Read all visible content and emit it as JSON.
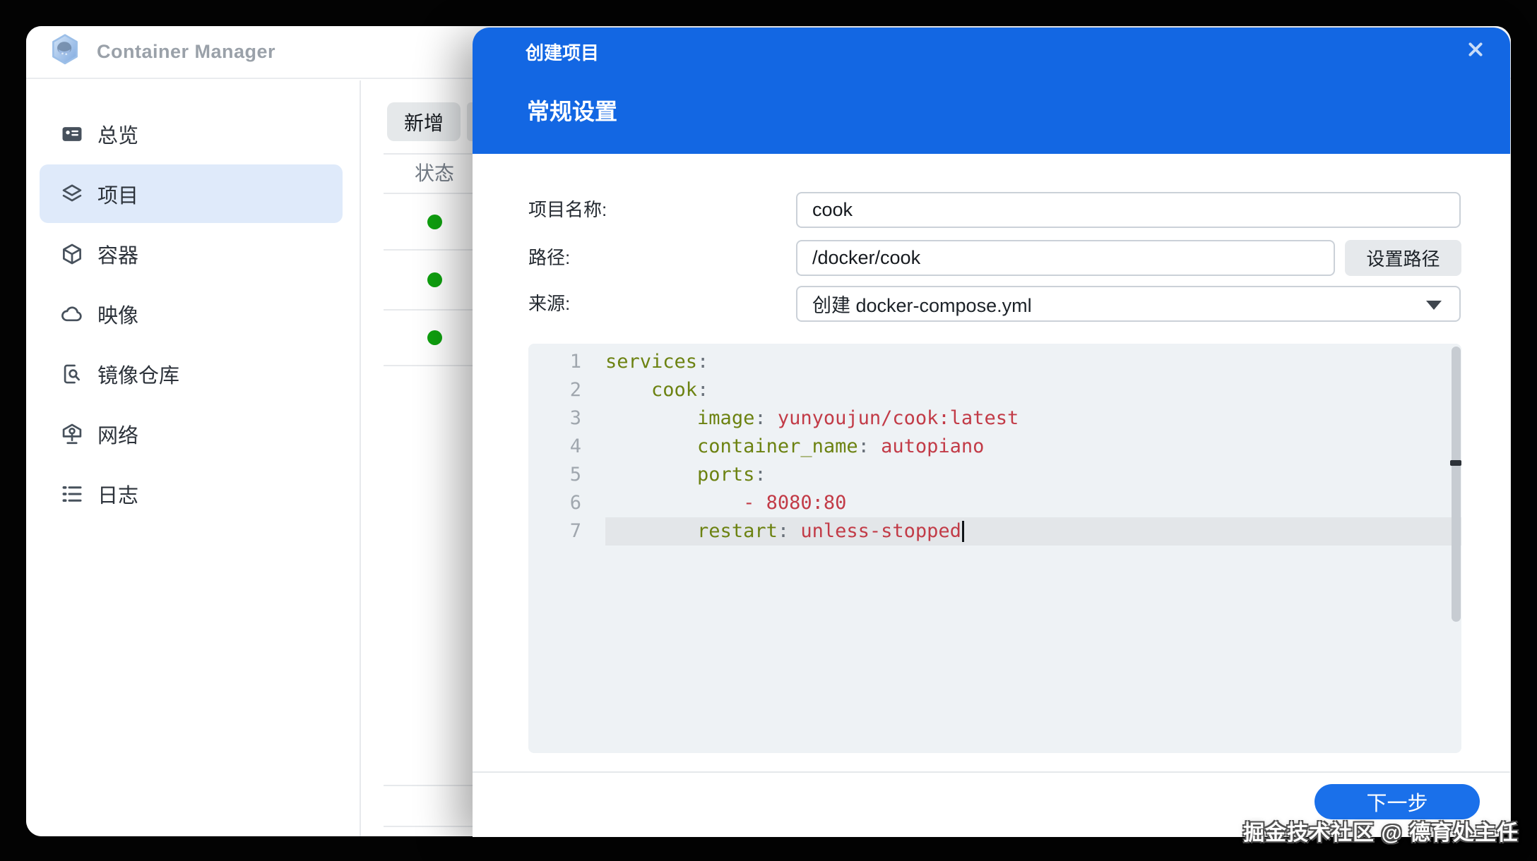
{
  "app": {
    "title": "Container Manager"
  },
  "sidebar": {
    "items": [
      {
        "id": "overview",
        "label": "总览",
        "active": false
      },
      {
        "id": "projects",
        "label": "项目",
        "active": true
      },
      {
        "id": "containers",
        "label": "容器",
        "active": false
      },
      {
        "id": "images",
        "label": "映像",
        "active": false
      },
      {
        "id": "registry",
        "label": "镜像仓库",
        "active": false
      },
      {
        "id": "network",
        "label": "网络",
        "active": false
      },
      {
        "id": "logs",
        "label": "日志",
        "active": false
      }
    ]
  },
  "content": {
    "add_button": "新增",
    "status_header": "状态",
    "rows": [
      {
        "status": "running"
      },
      {
        "status": "running"
      },
      {
        "status": "running"
      }
    ]
  },
  "modal": {
    "title": "创建项目",
    "section": "常规设置",
    "fields": {
      "name_label": "项目名称:",
      "name_value": "cook",
      "path_label": "路径:",
      "path_value": "/docker/cook",
      "path_button": "设置路径",
      "source_label": "来源:",
      "source_value": "创建 docker-compose.yml"
    },
    "editor": {
      "language": "yaml",
      "lines": [
        {
          "num": "1",
          "active": false,
          "cursor": false,
          "tokens": [
            [
              "key",
              "services"
            ],
            [
              "punct",
              ":"
            ]
          ]
        },
        {
          "num": "2",
          "active": false,
          "cursor": false,
          "tokens": [
            [
              "plain",
              "    "
            ],
            [
              "key",
              "cook"
            ],
            [
              "punct",
              ":"
            ]
          ]
        },
        {
          "num": "3",
          "active": false,
          "cursor": false,
          "tokens": [
            [
              "plain",
              "        "
            ],
            [
              "key",
              "image"
            ],
            [
              "punct",
              ": "
            ],
            [
              "val",
              "yunyoujun/cook:latest"
            ]
          ]
        },
        {
          "num": "4",
          "active": false,
          "cursor": false,
          "tokens": [
            [
              "plain",
              "        "
            ],
            [
              "key",
              "container_name"
            ],
            [
              "punct",
              ": "
            ],
            [
              "val",
              "autopiano"
            ]
          ]
        },
        {
          "num": "5",
          "active": false,
          "cursor": false,
          "tokens": [
            [
              "plain",
              "        "
            ],
            [
              "key",
              "ports"
            ],
            [
              "punct",
              ":"
            ]
          ]
        },
        {
          "num": "6",
          "active": false,
          "cursor": false,
          "tokens": [
            [
              "plain",
              "            "
            ],
            [
              "val",
              "- 8080:80"
            ]
          ]
        },
        {
          "num": "7",
          "active": true,
          "cursor": true,
          "tokens": [
            [
              "plain",
              "        "
            ],
            [
              "key",
              "restart"
            ],
            [
              "punct",
              ": "
            ],
            [
              "val",
              "unless-stopped"
            ]
          ]
        }
      ]
    },
    "next_button": "下一步"
  },
  "watermark": "掘金技术社区 @ 德育处主任",
  "colors": {
    "header_blue": "#1367e3",
    "button_blue": "#1a70ea",
    "status_green": "#0fa00f",
    "code_key": "#6c8211",
    "code_value": "#c23b47",
    "code_punct": "#6a727b",
    "code_gutter": "#a0a7ae",
    "sidebar_active_bg": "#dfeafa"
  }
}
